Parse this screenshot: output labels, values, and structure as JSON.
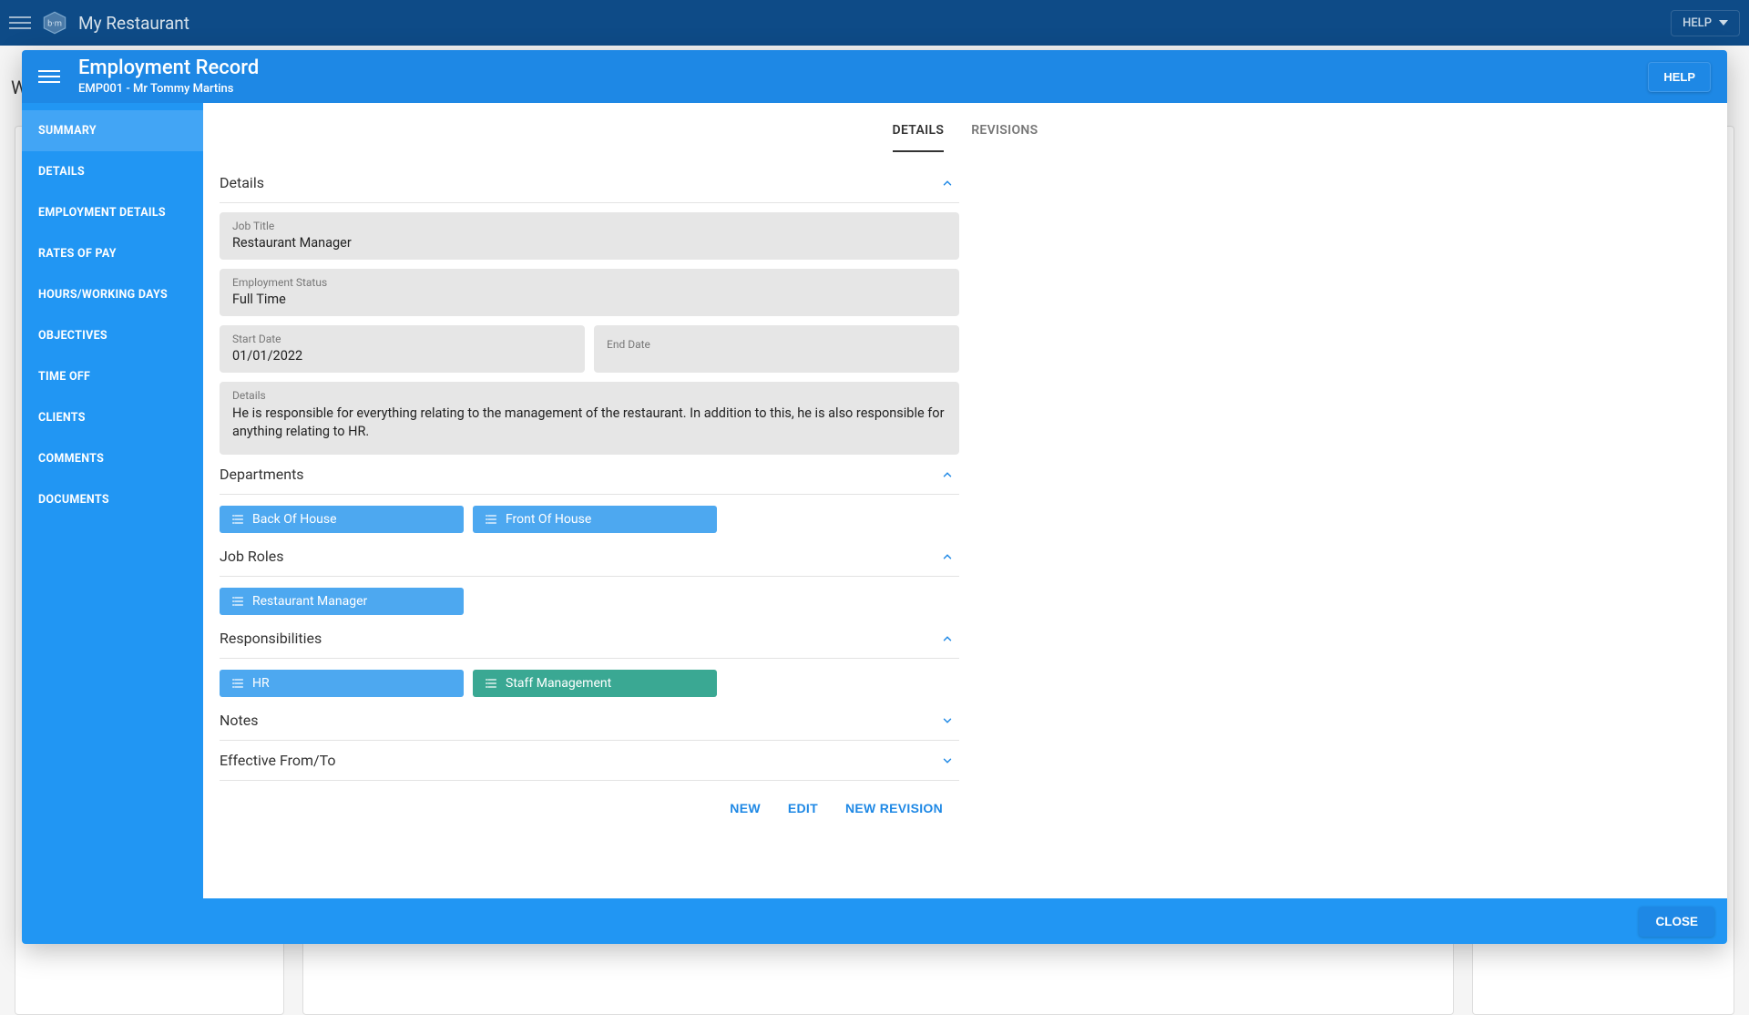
{
  "app": {
    "title": "My Restaurant",
    "help": "HELP"
  },
  "dialog": {
    "title": "Employment Record",
    "subtitle": "EMP001 - Mr Tommy Martins",
    "help": "HELP",
    "close": "CLOSE"
  },
  "sidebar": {
    "items": [
      "SUMMARY",
      "DETAILS",
      "EMPLOYMENT DETAILS",
      "RATES OF PAY",
      "HOURS/WORKING DAYS",
      "OBJECTIVES",
      "TIME OFF",
      "CLIENTS",
      "COMMENTS",
      "DOCUMENTS"
    ],
    "active_index": 0
  },
  "tabs": {
    "items": [
      "DETAILS",
      "REVISIONS"
    ],
    "active_index": 0
  },
  "sections": {
    "details": {
      "title": "Details",
      "expanded": true,
      "fields": {
        "job_title": {
          "label": "Job Title",
          "value": "Restaurant Manager"
        },
        "employment_status": {
          "label": "Employment Status",
          "value": "Full Time"
        },
        "start_date": {
          "label": "Start Date",
          "value": "01/01/2022"
        },
        "end_date": {
          "label": "End Date",
          "value": ""
        },
        "details_text": {
          "label": "Details",
          "value": "He is responsible for everything relating to the management of the restaurant. In addition to this, he is also responsible for anything relating to HR."
        }
      }
    },
    "departments": {
      "title": "Departments",
      "expanded": true,
      "chips": [
        "Back Of House",
        "Front Of House"
      ]
    },
    "job_roles": {
      "title": "Job Roles",
      "expanded": true,
      "chips": [
        "Restaurant Manager"
      ]
    },
    "responsibilities": {
      "title": "Responsibilities",
      "expanded": true,
      "chips": [
        {
          "label": "HR",
          "variant": "blue"
        },
        {
          "label": "Staff Management",
          "variant": "green"
        }
      ]
    },
    "notes": {
      "title": "Notes",
      "expanded": false
    },
    "effective": {
      "title": "Effective From/To",
      "expanded": false
    }
  },
  "actions": {
    "new": "NEW",
    "edit": "EDIT",
    "new_revision": "NEW REVISION"
  },
  "icons": {
    "list": "list-icon",
    "chevron_up": "chevron-up-icon",
    "chevron_down": "chevron-down-icon"
  }
}
